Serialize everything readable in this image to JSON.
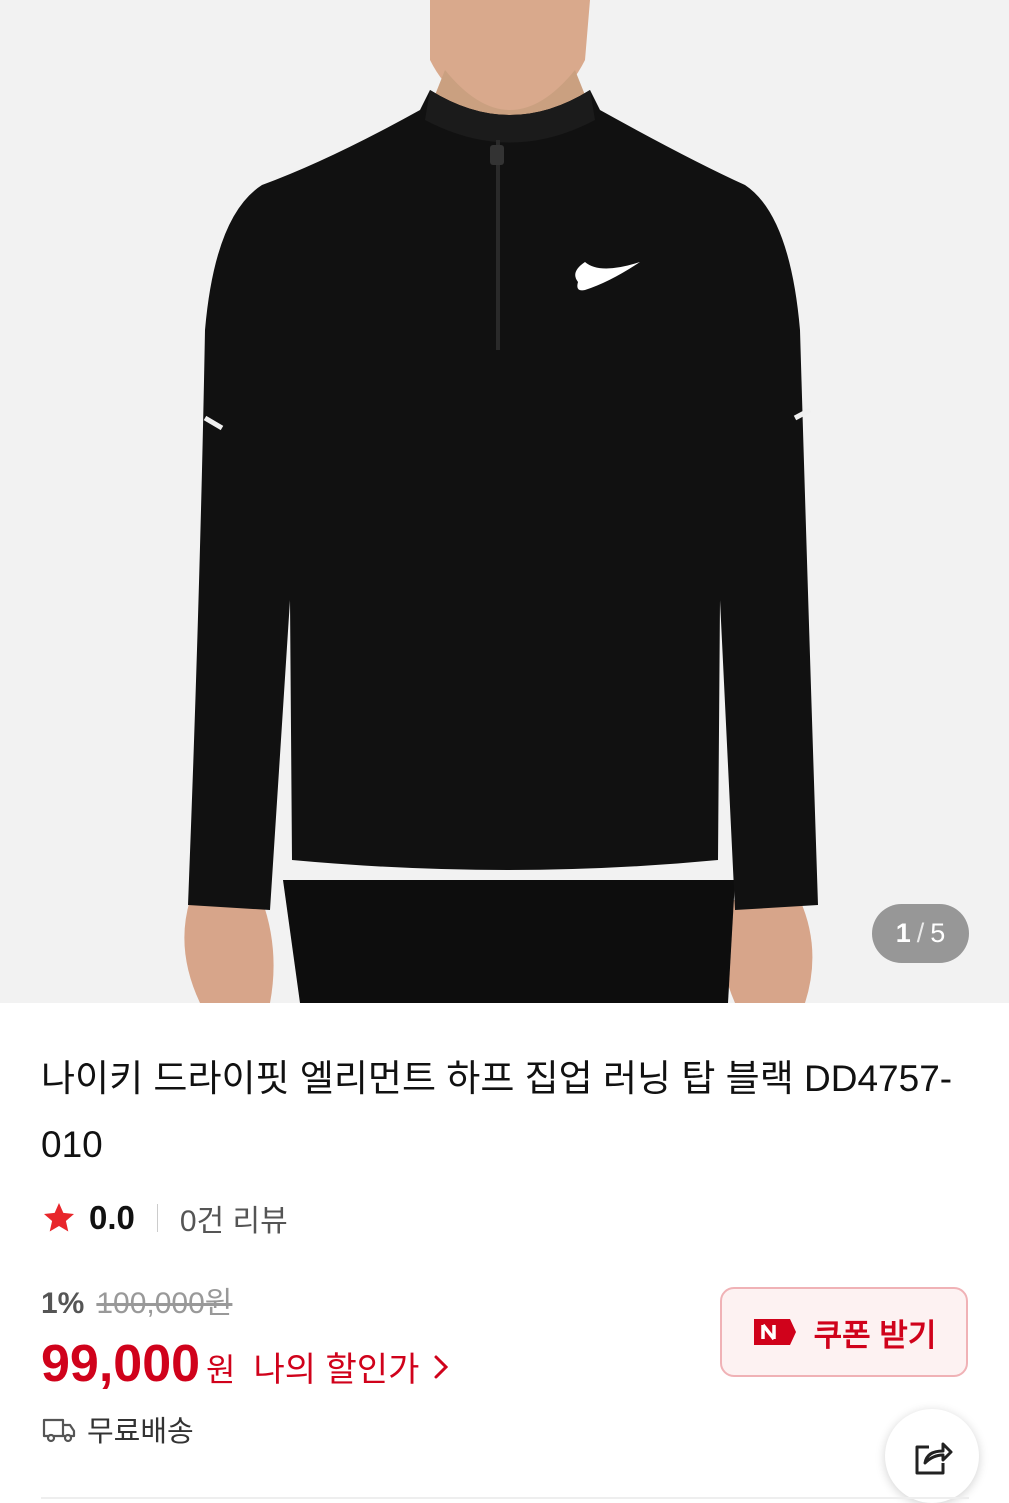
{
  "gallery": {
    "image_alt": "product-photo-black-half-zip-top",
    "page_current": "1",
    "page_separator": "/",
    "page_total": "5"
  },
  "product": {
    "title": "나이키 드라이핏 엘리먼트 하프 집업 러닝 탑 블랙 DD4757-010",
    "rating": "0.0",
    "review_text": "0건 리뷰",
    "discount_rate": "1%",
    "original_price": "100,000원",
    "sale_price": "99,000",
    "currency": "원",
    "my_discount_label": "나의 할인가"
  },
  "coupon": {
    "label": "쿠폰 받기",
    "icon": "naver-n-icon"
  },
  "shipping": {
    "label": "무료배송",
    "icon": "truck-icon"
  },
  "share": {
    "icon": "share-icon"
  },
  "colors": {
    "accent": "#d0021b",
    "star": "#e8262b",
    "coupon_bg": "#fdf2f2",
    "coupon_border": "#f0b2b6"
  }
}
